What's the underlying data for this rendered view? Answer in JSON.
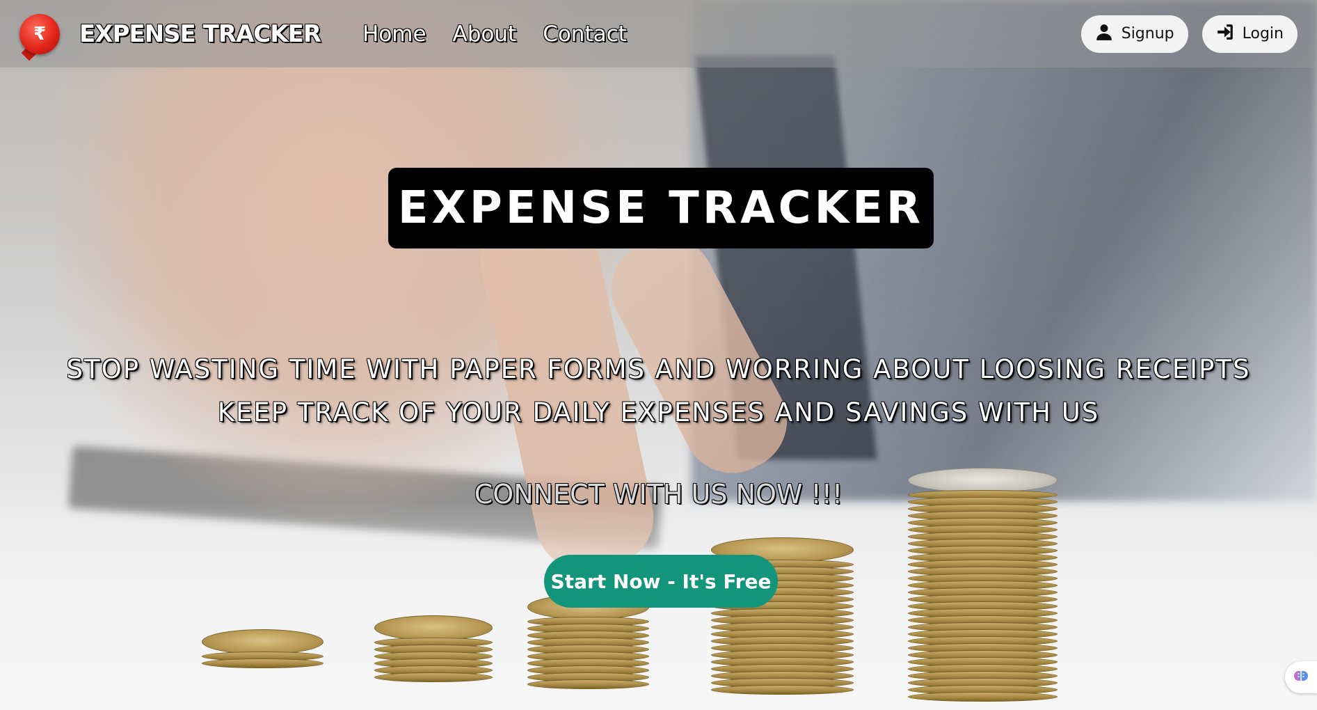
{
  "navbar": {
    "logo_symbol": "₹",
    "brand_name": "EXPENSE TRACKER",
    "links": [
      {
        "label": "Home"
      },
      {
        "label": "About"
      },
      {
        "label": "Contact"
      }
    ],
    "signup_label": "Signup",
    "login_label": "Login",
    "signup_icon": "user-icon",
    "login_icon": "sign-in-icon"
  },
  "hero": {
    "title": "EXPENSE TRACKER",
    "line1": "STOP WASTING TIME WITH PAPER FORMS AND WORRING ABOUT LOOSING RECEIPTS",
    "line2": "KEEP TRACK OF YOUR DAILY EXPENSES AND SAVINGS WITH US",
    "connect": "CONNECT WITH US NOW !!!",
    "cta_label": "Start Now - It's Free",
    "cta_color": "#12957a"
  },
  "widget": {
    "icon": "brain-icon"
  }
}
